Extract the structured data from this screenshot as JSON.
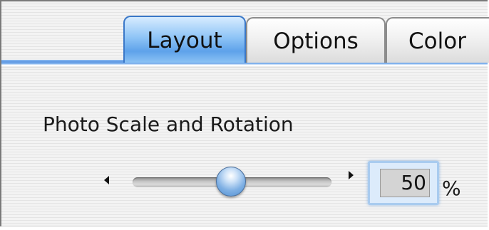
{
  "tabs": [
    {
      "label": "Layout",
      "selected": true
    },
    {
      "label": "Options",
      "selected": false
    },
    {
      "label": "Color",
      "selected": false
    }
  ],
  "section": {
    "title": "Photo Scale and Rotation"
  },
  "scale": {
    "value": "50",
    "unit": "%",
    "slider_fraction": 0.5
  },
  "colors": {
    "accent": "#5ea2ea"
  }
}
